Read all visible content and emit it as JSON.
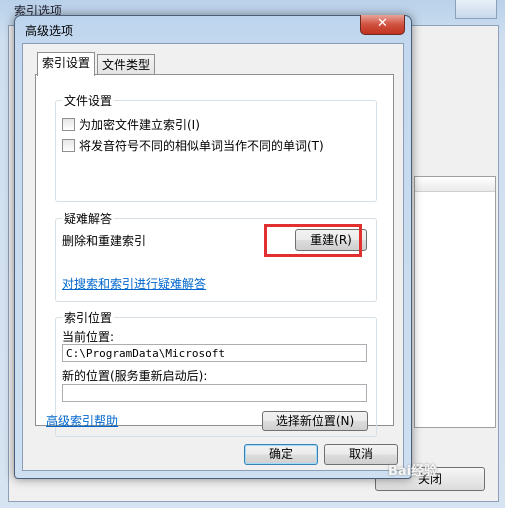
{
  "background_window": {
    "title": "索引选项",
    "close_label": "关闭"
  },
  "dialog": {
    "title": "高级选项",
    "close_glyph": "✕"
  },
  "tabs": [
    {
      "label": "索引设置"
    },
    {
      "label": "文件类型"
    }
  ],
  "file_settings": {
    "title": "文件设置",
    "checkbox_encrypt": "为加密文件建立索引(I)",
    "checkbox_diacritics": "将发音符号不同的相似单词当作不同的单词(T)"
  },
  "troubleshoot": {
    "title": "疑难解答",
    "label": "删除和重建索引",
    "rebuild_label": "重建(R)",
    "link": "对搜索和索引进行疑难解答"
  },
  "index_location": {
    "title": "索引位置",
    "current_label": "当前位置:",
    "current_value": "C:\\ProgramData\\Microsoft",
    "new_label": "新的位置(服务重新启动后):",
    "new_value": "",
    "select_new_label": "选择新位置(N)"
  },
  "help_link": "高级索引帮助",
  "footer": {
    "ok_label": "确定",
    "cancel_label": "取消"
  },
  "watermark": "Bai经验",
  "colors": {
    "highlight": "#e03030",
    "link": "#0066cc"
  }
}
